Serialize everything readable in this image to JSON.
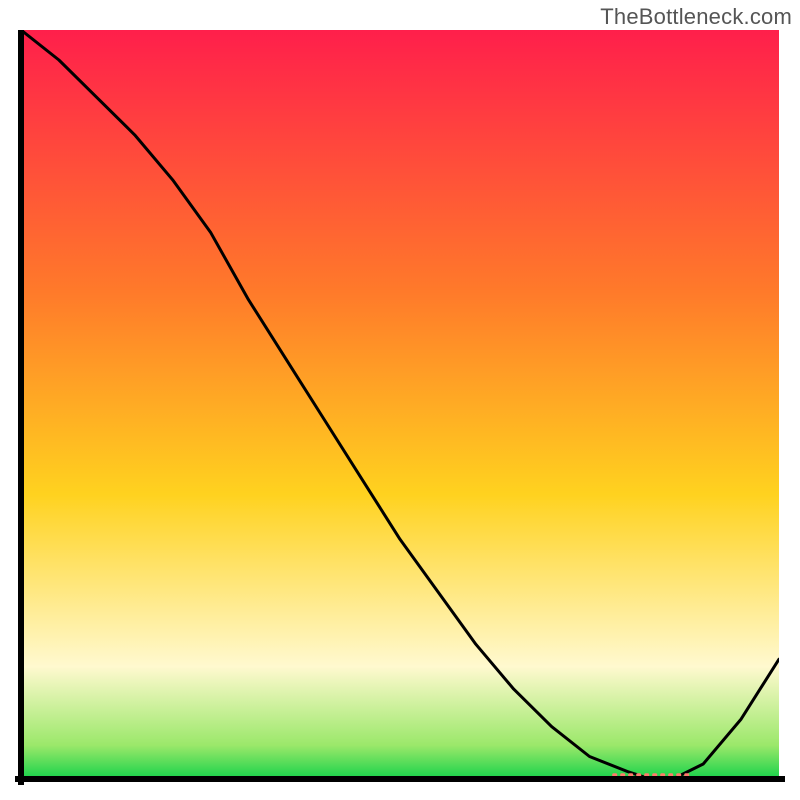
{
  "watermark": "TheBottleneck.com",
  "colors": {
    "top": "#ff1f4b",
    "mid1": "#ff7a2a",
    "mid2": "#ffd21f",
    "low": "#fff9cf",
    "green_top": "#9be86a",
    "green_bot": "#17d24a",
    "axis": "#000000",
    "curve": "#000000",
    "marker": "#ff7a6a"
  },
  "chart_data": {
    "type": "line",
    "title": "",
    "xlabel": "",
    "ylabel": "",
    "xlim": [
      0,
      100
    ],
    "ylim": [
      0,
      100
    ],
    "series": [
      {
        "name": "curve",
        "x": [
          0,
          5,
          10,
          15,
          20,
          25,
          30,
          35,
          40,
          45,
          50,
          55,
          60,
          65,
          70,
          75,
          80,
          83,
          86,
          90,
          95,
          100
        ],
        "values": [
          100,
          96,
          91,
          86,
          80,
          73,
          64,
          56,
          48,
          40,
          32,
          25,
          18,
          12,
          7,
          3,
          1,
          0,
          0,
          2,
          8,
          16
        ]
      }
    ],
    "marker_band": {
      "x_start": 78,
      "x_end": 88,
      "y": 0.5
    }
  }
}
